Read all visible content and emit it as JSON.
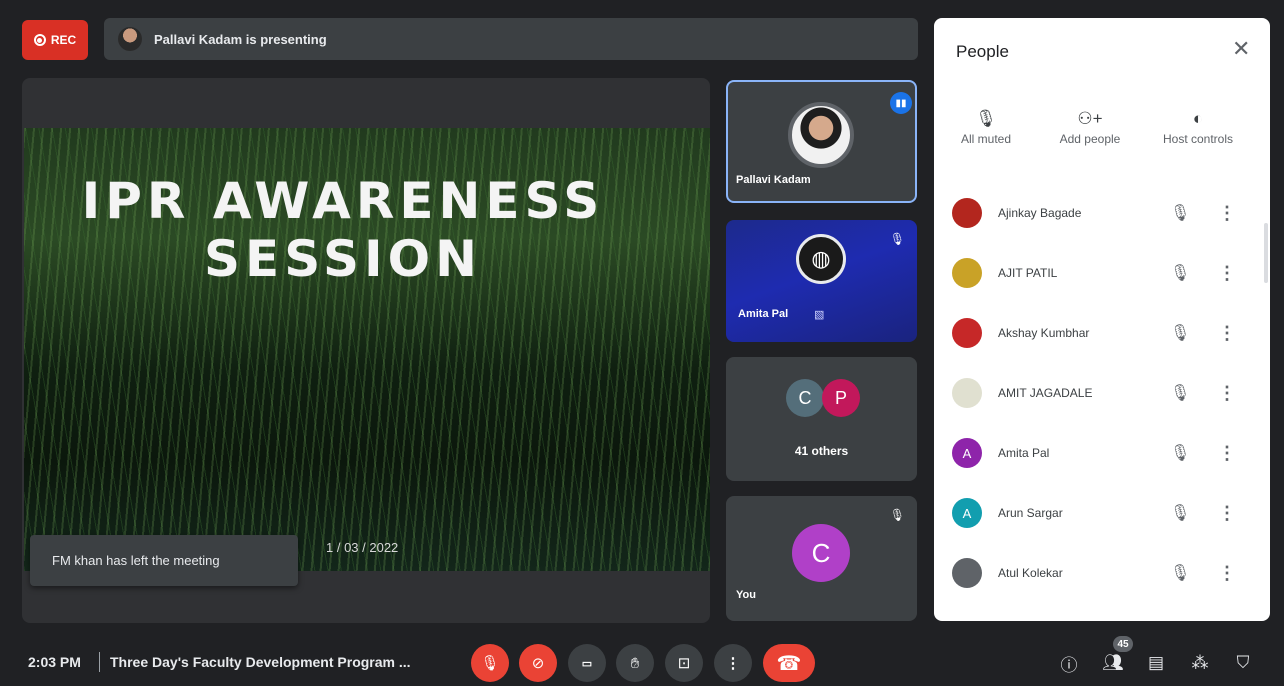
{
  "topbar": {
    "rec_label": "REC",
    "presenting_text": "Pallavi Kadam is presenting"
  },
  "stage": {
    "slide_title_line1": "IPR AWARENESS",
    "slide_title_line2": "SESSION",
    "slide_date": "1 / 03 / 2022",
    "toast": "FM khan has left the meeting"
  },
  "tiles": [
    {
      "name": "Pallavi Kadam"
    },
    {
      "name": "Amita Pal"
    },
    {
      "name": "41 others",
      "avatars": [
        "C",
        "P"
      ]
    },
    {
      "name": "You",
      "avatar": "C"
    }
  ],
  "panel": {
    "title": "People",
    "actions": [
      {
        "label": "All muted",
        "icon": "mic-off-icon"
      },
      {
        "label": "Add people",
        "icon": "person-add-icon"
      },
      {
        "label": "Host controls",
        "icon": "toggle-icon"
      }
    ],
    "people": [
      {
        "name": "Ajinkay Bagade",
        "initial": "",
        "color": "#b3261e"
      },
      {
        "name": "AJIT PATIL",
        "initial": "",
        "color": "#c9a227"
      },
      {
        "name": "Akshay Kumbhar",
        "initial": "",
        "color": "#c62828"
      },
      {
        "name": "AMIT JAGADALE",
        "initial": "",
        "color": "#e0e0d0"
      },
      {
        "name": "Amita Pal",
        "initial": "A",
        "color": "#8e24aa"
      },
      {
        "name": "Arun Sargar",
        "initial": "A",
        "color": "#129eaf"
      },
      {
        "name": "Atul Kolekar",
        "initial": "",
        "color": "#5f6368"
      }
    ]
  },
  "bottombar": {
    "time": "2:03 PM",
    "meeting_title": "Three Day's Faculty Development Program ...",
    "participant_count": "45"
  }
}
